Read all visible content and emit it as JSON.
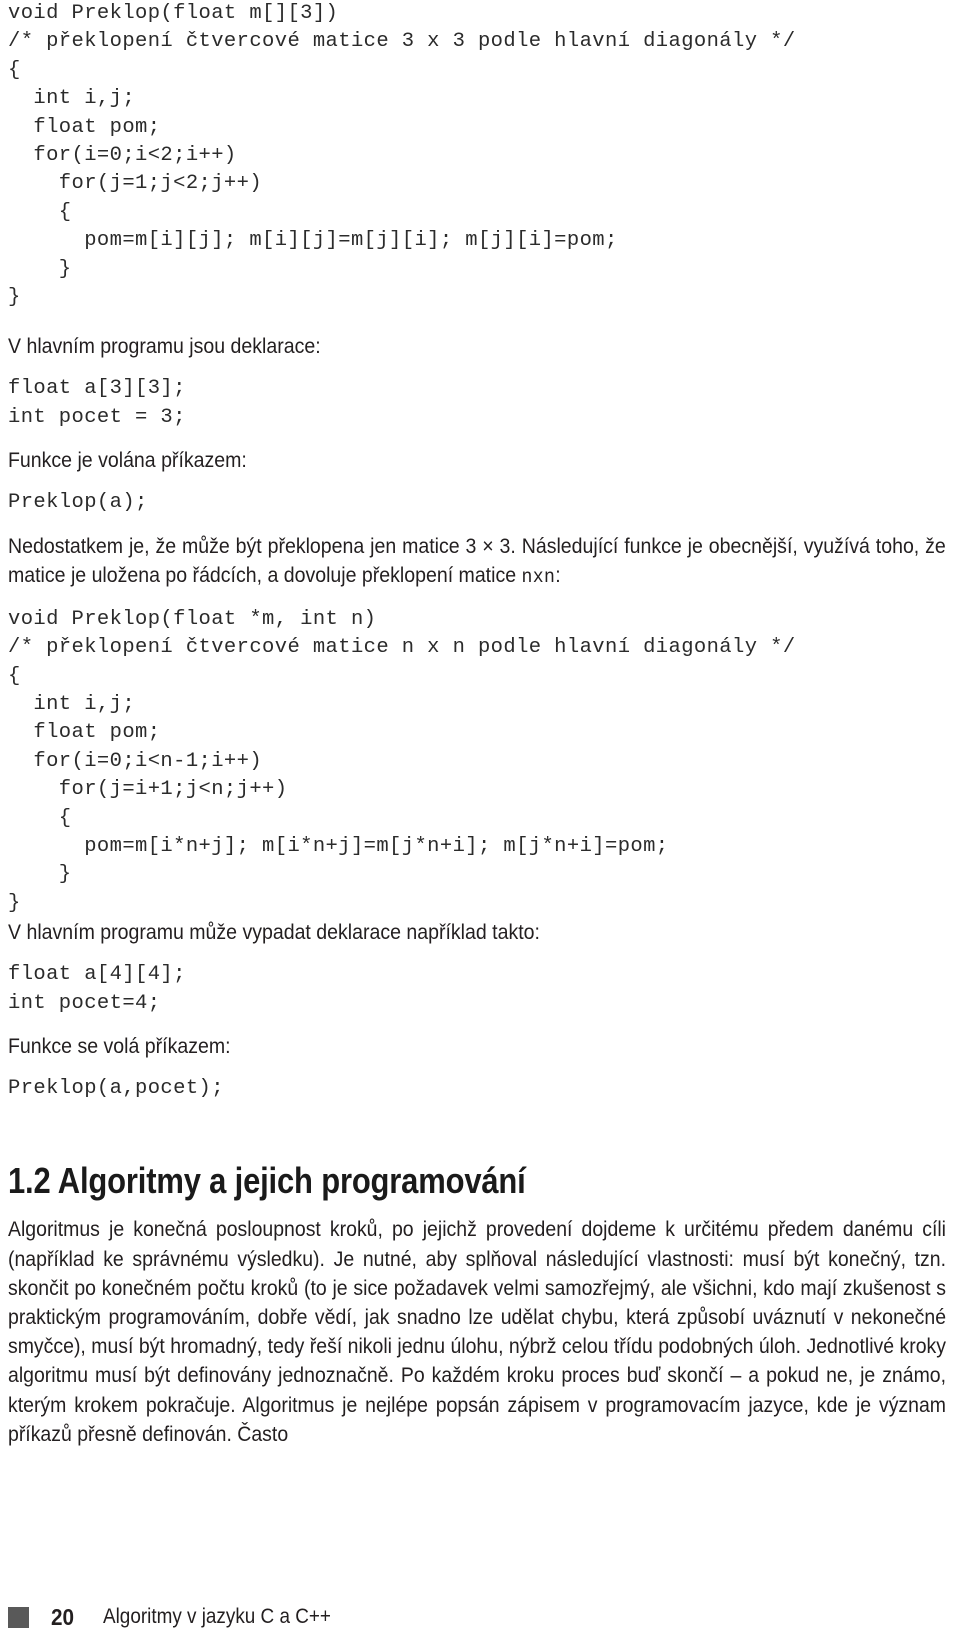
{
  "page": {
    "number": "20",
    "running_title": "Algoritmy v jazyku C a C++"
  },
  "code_block_1": "void Preklop(float m[][3])\n/* překlopení čtvercové matice 3 x 3 podle hlavní diagonály */\n{\n  int i,j;\n  float pom;\n  for(i=0;i<2;i++)\n    for(j=1;j<2;j++)\n    {\n      pom=m[i][j]; m[i][j]=m[j][i]; m[j][i]=pom;\n    }\n}",
  "para_1": "V hlavním programu jsou deklarace:",
  "code_block_2": "float a[3][3];\nint pocet = 3;",
  "para_2": "Funkce je volána příkazem:",
  "code_block_3": "Preklop(a);",
  "para_3": {
    "text_before": "Nedostatkem je, že může být překlopena jen matice 3 × 3. Následující funkce je obecnější, využívá toho, že matice je uložena po řádcích, a dovoluje překlopení matice ",
    "mono": "nxn",
    "text_after": ":"
  },
  "code_block_4": "void Preklop(float *m, int n)\n/* překlopení čtvercové matice n x n podle hlavní diagonály */\n{\n  int i,j;\n  float pom;\n  for(i=0;i<n-1;i++)\n    for(j=i+1;j<n;j++)\n    {\n      pom=m[i*n+j]; m[i*n+j]=m[j*n+i]; m[j*n+i]=pom;\n    }\n}",
  "para_4": "V hlavním programu může vypadat deklarace například takto:",
  "code_block_5": "float a[4][4];\nint pocet=4;",
  "para_5": "Funkce se volá příkazem:",
  "code_block_6": "Preklop(a,pocet);",
  "section": {
    "heading": "1.2 Algoritmy a jejich programování",
    "body": "Algoritmus je konečná posloupnost kroků, po jejichž provedení dojdeme k určitému předem danému cíli (například ke správnému výsledku). Je nutné, aby splňoval následující vlastnosti: musí být konečný, tzn. skončit po konečném počtu kroků (to je sice požadavek velmi samozřejmý, ale všichni, kdo mají zkušenost s praktickým programováním, dobře vědí, jak snadno lze udělat chybu, která způsobí uváznutí v nekonečné smyčce), musí být hromadný, tedy řeší nikoli jednu úlohu, nýbrž celou třídu podobných úloh. Jednotlivé kroky algoritmu musí být definovány jednoznačně. Po každém kroku proces buď skončí – a pokud ne, je známo, kterým krokem pokračuje. Algoritmus je nejlépe popsán zápisem v programovacím jazyce, kde je význam příkazů přesně definován. Často"
  }
}
